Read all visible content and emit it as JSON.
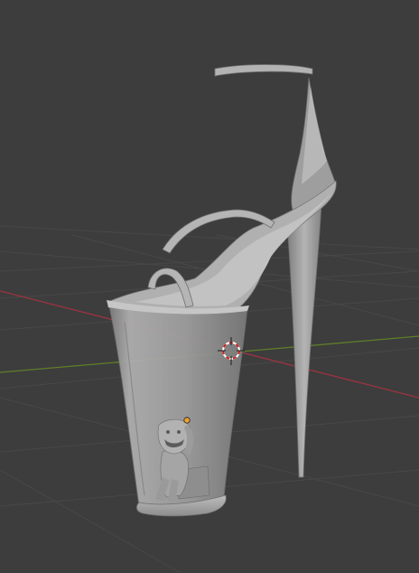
{
  "viewport": {
    "background": "#3d3d3d",
    "grid_color": "#494949",
    "x_axis_color": "#a33a44",
    "y_axis_color": "#6a8a2a",
    "model_color": "#a7a7a7",
    "model_shadow": "#6f6f6f",
    "model_highlight": "#cfcfcf",
    "origin_color": "#f0a030",
    "cursor_colors": [
      "#cc2222",
      "#ffffff"
    ],
    "objects": [
      "platform-sandal",
      "toy-figure"
    ]
  }
}
